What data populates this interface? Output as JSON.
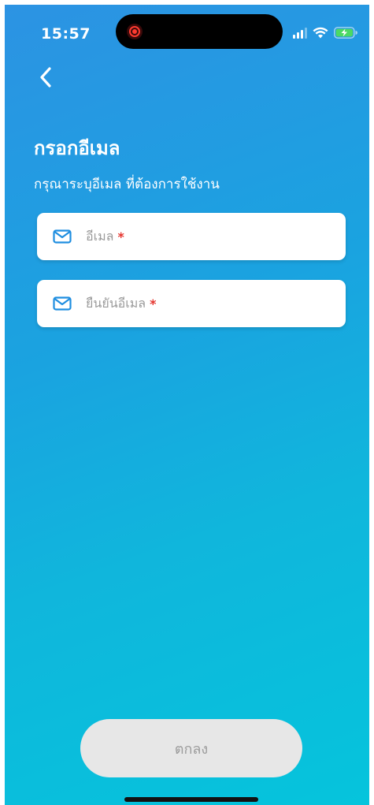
{
  "status_bar": {
    "time": "15:57"
  },
  "header": {
    "title": "กรอกอีเมล",
    "subtitle": "กรุณาระบุอีเมล ที่ต้องการใช้งาน"
  },
  "form": {
    "email": {
      "placeholder": "อีเมล",
      "required_mark": "*",
      "icon": "mail-icon"
    },
    "confirm_email": {
      "placeholder": "ยืนยันอีเมล",
      "required_mark": "*",
      "icon": "mail-icon"
    }
  },
  "actions": {
    "submit_label": "ตกลง"
  },
  "colors": {
    "gradient_start": "#2c93e3",
    "gradient_end": "#05c4dc",
    "icon_blue": "#1f8ee0",
    "required_red": "#e5342d",
    "button_disabled_bg": "#e7e7e7",
    "button_disabled_text": "#9c9c9c"
  }
}
